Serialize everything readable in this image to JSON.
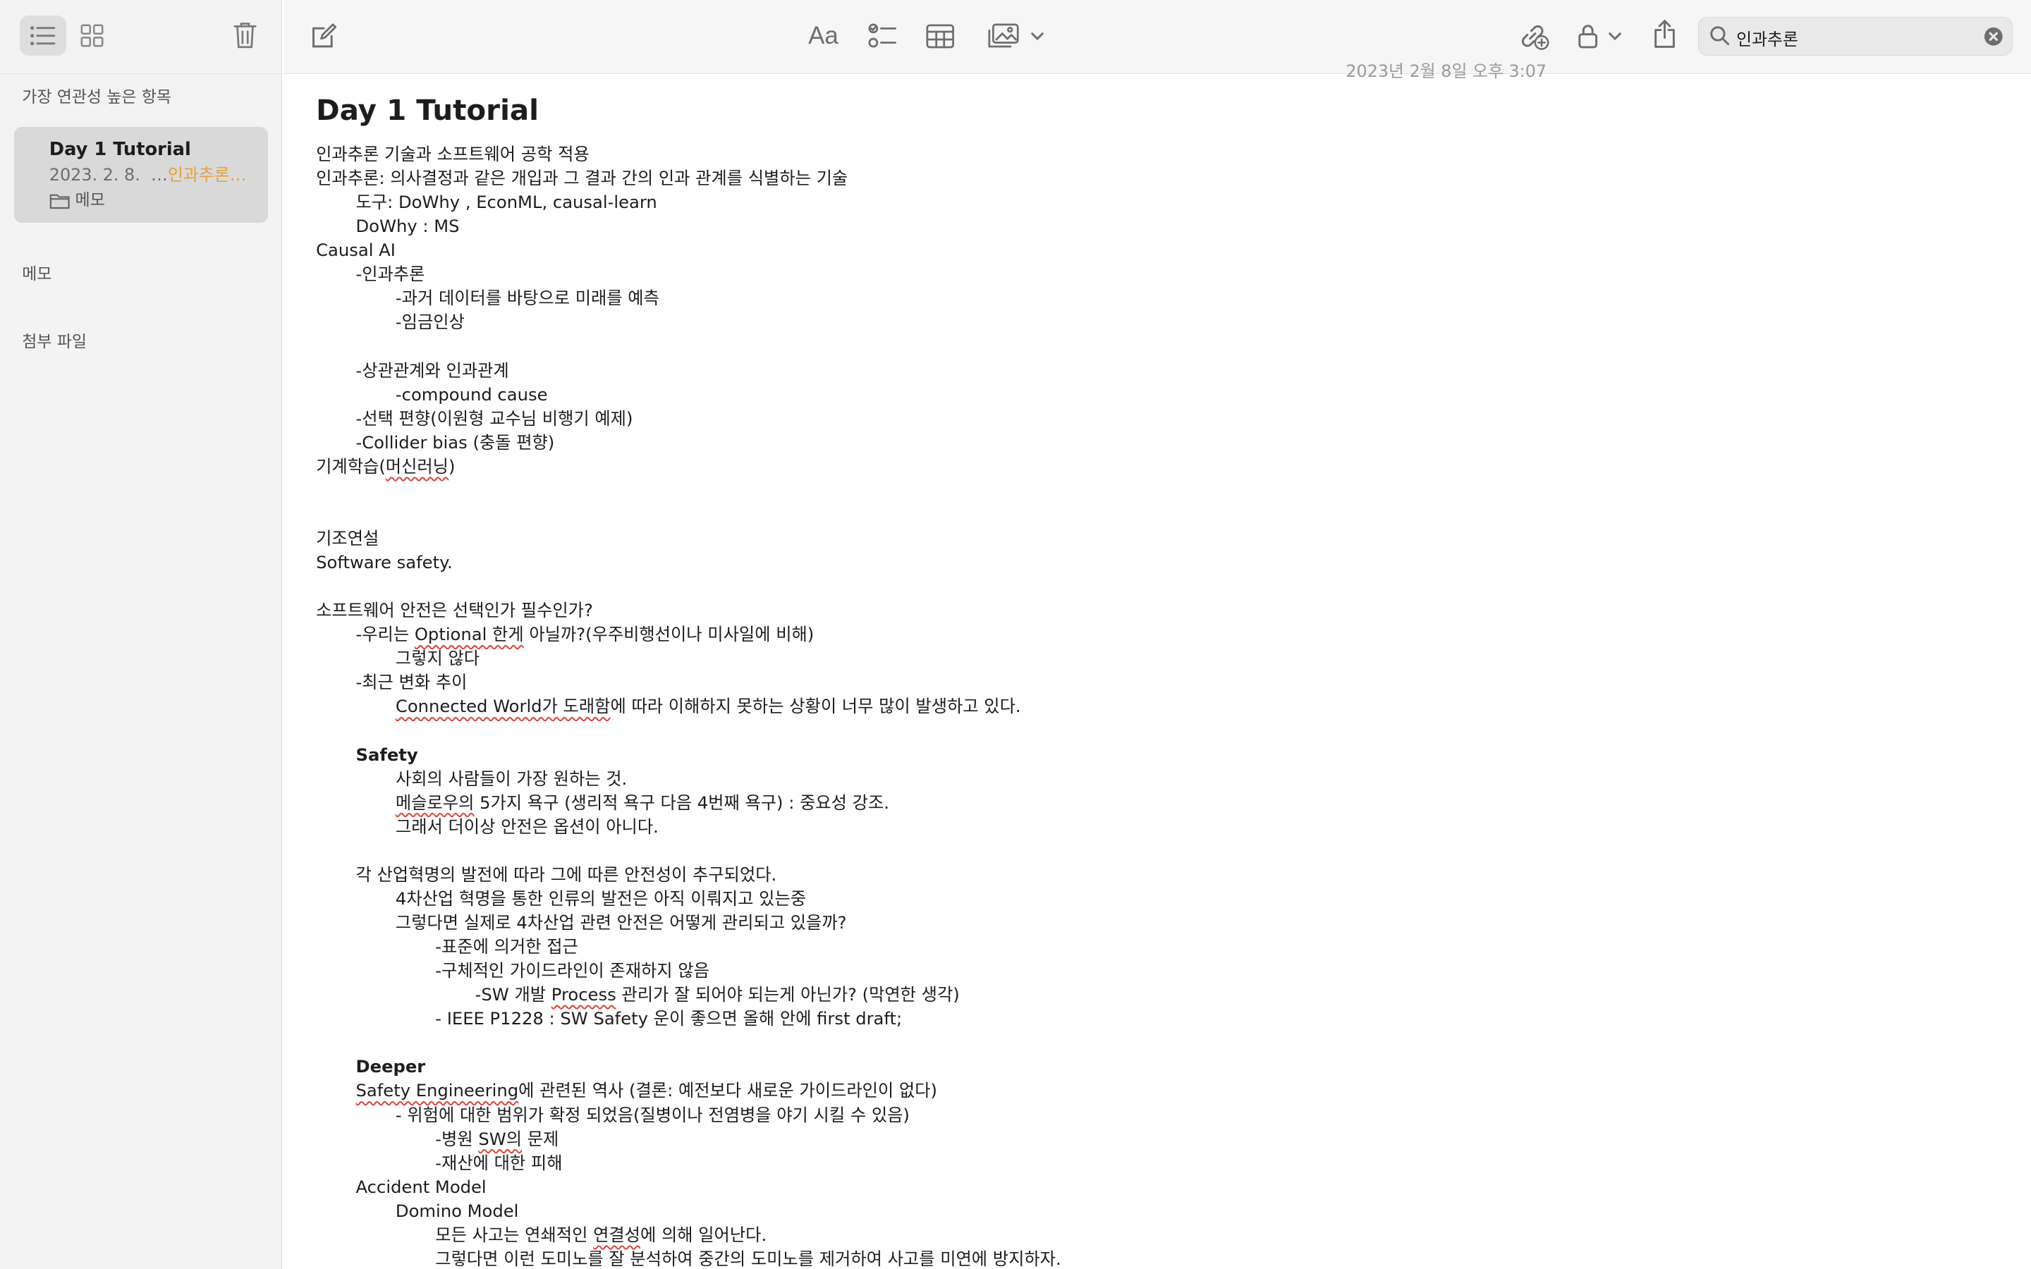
{
  "sidebar": {
    "top_results_label": "가장 연관성 높은 항목",
    "note_card": {
      "title": "Day 1 Tutorial",
      "date": "2023. 2. 8.",
      "snippet_prefix": "…",
      "snippet_highlight": "인과추론…",
      "folder": "메모"
    },
    "notes_section_label": "메모",
    "attachments_section_label": "첨부 파일"
  },
  "toolbar": {
    "format_label": "Aa",
    "search_value": "인과추론",
    "header_date_partial": "2023년 2월 8일 오후 3:07"
  },
  "note": {
    "title": "Day 1 Tutorial",
    "lines": [
      {
        "indent": 0,
        "text": "인과추론 기술과 소프트웨어 공학 적용"
      },
      {
        "indent": 0,
        "text": "인과추론: 의사결정과 같은 개입과 그 결과 간의 인과 관계를 식별하는 기술"
      },
      {
        "indent": 1,
        "text": "도구: DoWhy , EconML, causal-learn"
      },
      {
        "indent": 1,
        "text": "DoWhy : MS"
      },
      {
        "indent": 0,
        "text": "Causal AI"
      },
      {
        "indent": 1,
        "text": "-인과추론"
      },
      {
        "indent": 2,
        "text": "-과거 데이터를 바탕으로 미래를 예측"
      },
      {
        "indent": 2,
        "text": "-임금인상"
      },
      {
        "indent": 0,
        "text": ""
      },
      {
        "indent": 1,
        "text": "-상관관계와 인과관계"
      },
      {
        "indent": 2,
        "text": "-compound cause"
      },
      {
        "indent": 1,
        "text": "-선택 편향(이원형 교수님 비행기 예제)"
      },
      {
        "indent": 1,
        "text": "-Collider bias (충돌 편향)"
      },
      {
        "indent": 0,
        "text": "기계학습(머신러닝)",
        "spell": "머신러닝"
      },
      {
        "indent": 0,
        "text": ""
      },
      {
        "indent": 0,
        "text": ""
      },
      {
        "indent": 0,
        "text": "기조연설"
      },
      {
        "indent": 0,
        "text": "Software safety."
      },
      {
        "indent": 0,
        "text": ""
      },
      {
        "indent": 0,
        "text": "소프트웨어 안전은 선택인가 필수인가?"
      },
      {
        "indent": 1,
        "text": "-우리는 Optional 한게 아닐까?(우주비행선이나 미사일에 비해)",
        "spell": "Optional 한게"
      },
      {
        "indent": 2,
        "text": "그렇지 않다"
      },
      {
        "indent": 1,
        "text": "-최근 변화 추이"
      },
      {
        "indent": 2,
        "text": "Connected World가 도래함에 따라 이해하지 못하는 상황이 너무 많이 발생하고 있다.",
        "spell": "Connected World가 도래함"
      },
      {
        "indent": 0,
        "text": ""
      },
      {
        "indent": 1,
        "text": "Safety",
        "bold": true
      },
      {
        "indent": 2,
        "text": "사회의 사람들이 가장 원하는 것."
      },
      {
        "indent": 2,
        "text": "메슬로우의 5가지 욕구 (생리적 욕구 다음 4번째 욕구) : 중요성 강조.",
        "spell": "메슬로우의"
      },
      {
        "indent": 2,
        "text": "그래서 더이상 안전은 옵션이 아니다."
      },
      {
        "indent": 0,
        "text": ""
      },
      {
        "indent": 1,
        "text": "각 산업혁명의 발전에 따라 그에 따른 안전성이 추구되었다."
      },
      {
        "indent": 2,
        "text": "4차산업 혁명을 통한 인류의 발전은 아직 이뤄지고 있는중"
      },
      {
        "indent": 2,
        "text": "그렇다면 실제로 4차산업 관련 안전은 어떻게 관리되고 있을까?"
      },
      {
        "indent": 3,
        "text": "-표준에 의거한 접근"
      },
      {
        "indent": 3,
        "text": "-구체적인 가이드라인이 존재하지 않음"
      },
      {
        "indent": 4,
        "text": "-SW 개발 Process 관리가 잘 되어야 되는게 아닌가? (막연한 생각)",
        "spell": "Process"
      },
      {
        "indent": 3,
        "text": "- IEEE P1228 : SW Safety 운이 좋으면 올해 안에 first draft;"
      },
      {
        "indent": 0,
        "text": ""
      },
      {
        "indent": 1,
        "text": "Deeper",
        "bold": true
      },
      {
        "indent": 1,
        "text": "Safety Engineering에 관련된 역사 (결론: 예전보다 새로운 가이드라인이 없다)",
        "spell": "Safety Engineering"
      },
      {
        "indent": 2,
        "text": "- 위험에 대한 범위가 확정 되었음(질병이나 전염병을 야기 시킬 수 있음)"
      },
      {
        "indent": 3,
        "text": "-병원 SW의 문제",
        "spell": "SW의"
      },
      {
        "indent": 3,
        "text": "-재산에 대한 피해"
      },
      {
        "indent": 1,
        "text": "Accident Model"
      },
      {
        "indent": 2,
        "text": "Domino Model"
      },
      {
        "indent": 3,
        "text": "모든 사고는 연쇄적인 연결성에 의해 일어난다.",
        "spell": "연결성"
      },
      {
        "indent": 3,
        "text": "그렇다면 이런 도미노를 잘 분석하여 중간의 도미노를 제거하여 사고를 미연에 방지하자."
      }
    ]
  }
}
